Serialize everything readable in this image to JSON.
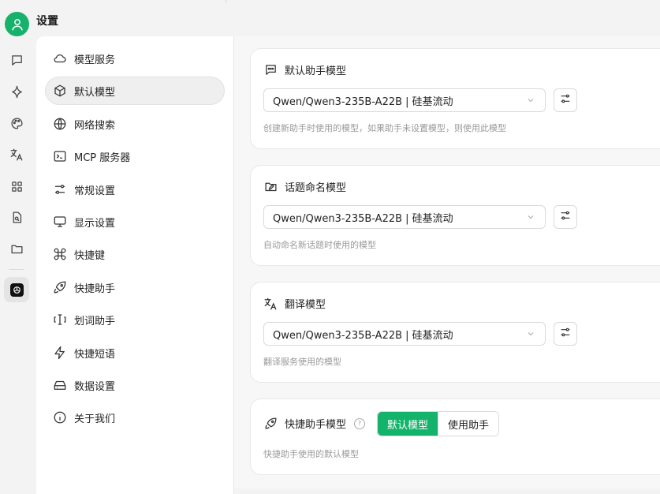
{
  "app": {
    "title": "设置"
  },
  "rail": {
    "icons": [
      "chat-icon",
      "sparkle-icon",
      "palette-icon",
      "translate-icon",
      "apps-grid-icon",
      "file-search-icon",
      "folder-icon",
      "openai-icon"
    ]
  },
  "menu": {
    "items": [
      {
        "label": "模型服务",
        "icon": "cloud-icon"
      },
      {
        "label": "默认模型",
        "icon": "cube-icon",
        "active": true
      },
      {
        "label": "网络搜索",
        "icon": "globe-icon"
      },
      {
        "label": "MCP 服务器",
        "icon": "terminal-icon"
      },
      {
        "label": "常规设置",
        "icon": "sliders-icon"
      },
      {
        "label": "显示设置",
        "icon": "monitor-icon"
      },
      {
        "label": "快捷键",
        "icon": "command-icon"
      },
      {
        "label": "快捷助手",
        "icon": "rocket-icon"
      },
      {
        "label": "划词助手",
        "icon": "text-cursor-icon"
      },
      {
        "label": "快捷短语",
        "icon": "lightning-icon"
      },
      {
        "label": "数据设置",
        "icon": "hard-drive-icon"
      },
      {
        "label": "关于我们",
        "icon": "info-icon"
      }
    ]
  },
  "cards": {
    "default_assistant": {
      "title": "默认助手模型",
      "selected_model": "Qwen/Qwen3-235B-A22B | 硅基流动",
      "description": "创建新助手时使用的模型，如果助手未设置模型，则使用此模型"
    },
    "topic_naming": {
      "title": "话题命名模型",
      "selected_model": "Qwen/Qwen3-235B-A22B | 硅基流动",
      "description": "自动命名新话题时使用的模型"
    },
    "translate": {
      "title": "翻译模型",
      "selected_model": "Qwen/Qwen3-235B-A22B | 硅基流动",
      "description": "翻译服务使用的模型"
    },
    "quick_assistant": {
      "title": "快捷助手模型",
      "help": "?",
      "option_default": "默认模型",
      "option_assistant": "使用助手",
      "selected": "默认模型",
      "description": "快捷助手使用的默认模型"
    }
  },
  "colors": {
    "accent": "#14b36b",
    "avatar": "#16b16b"
  }
}
